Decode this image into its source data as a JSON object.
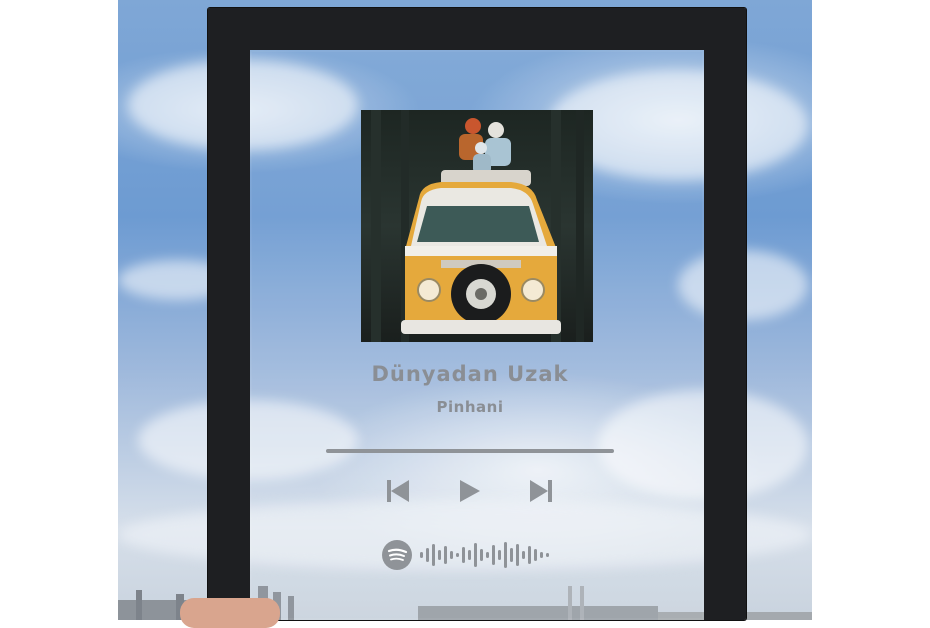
{
  "song": {
    "title": "Dünyadan Uzak",
    "artist": "Pinhani"
  },
  "player": {
    "progress": 0.0,
    "controls": [
      "previous-icon",
      "play-icon",
      "next-icon"
    ]
  },
  "colors": {
    "frame": "#1e1f22",
    "print_gray": "#8a8e94",
    "sky": "#6d9bd2",
    "van_yellow": "#e5a93c"
  }
}
